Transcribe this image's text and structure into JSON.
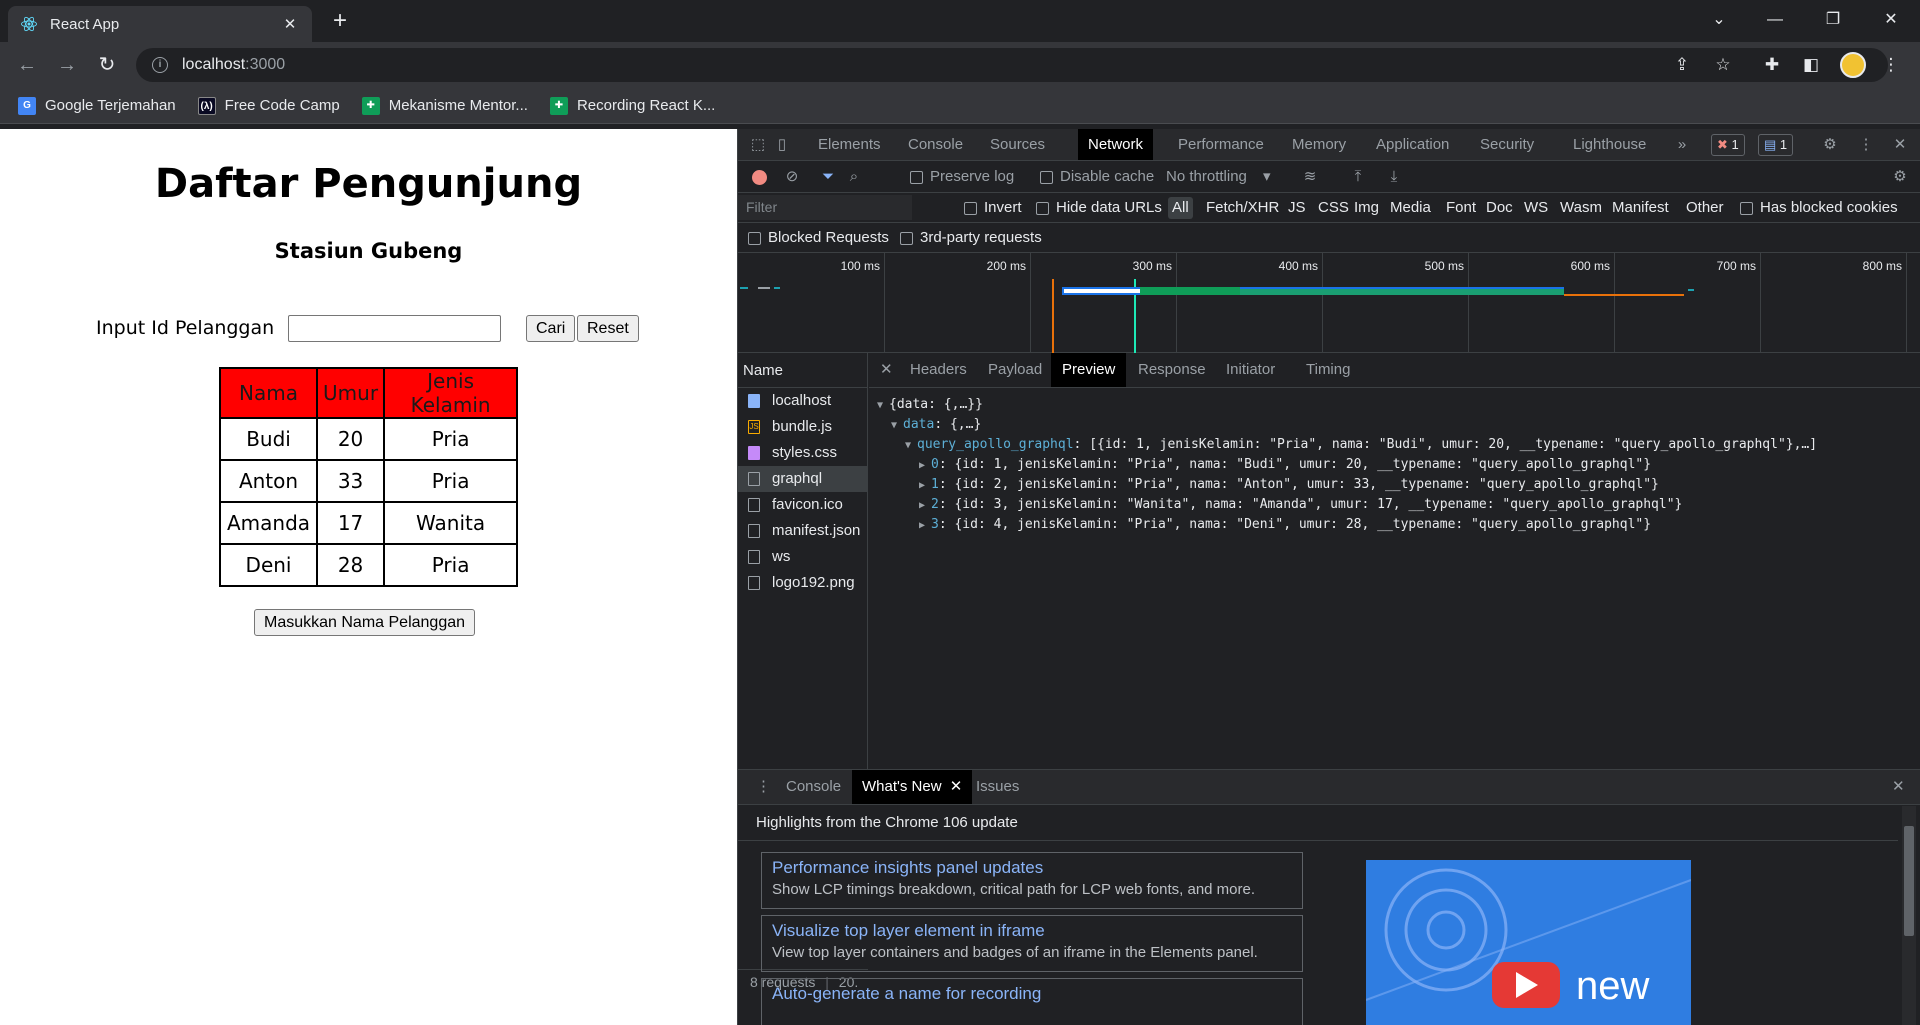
{
  "browser": {
    "tab_title": "React App",
    "url_host": "localhost",
    "url_port": ":3000",
    "bookmarks": [
      {
        "label": "Google Terjemahan",
        "icon": "google-translate-icon"
      },
      {
        "label": "Free Code Camp",
        "icon": "freecodecamp-icon"
      },
      {
        "label": "Mekanisme Mentor...",
        "icon": "sheets-icon"
      },
      {
        "label": "Recording React K...",
        "icon": "sheets-icon"
      }
    ]
  },
  "page": {
    "title": "Daftar Pengunjung",
    "subtitle": "Stasiun Gubeng",
    "input_label": "Input Id Pelanggan",
    "input_value": "",
    "search_button": "Cari",
    "reset_button": "Reset",
    "table_headers": [
      "Nama",
      "Umur",
      "Jenis Kelamin"
    ],
    "rows": [
      [
        "Budi",
        "20",
        "Pria"
      ],
      [
        "Anton",
        "33",
        "Pria"
      ],
      [
        "Amanda",
        "17",
        "Wanita"
      ],
      [
        "Deni",
        "28",
        "Pria"
      ]
    ],
    "add_button": "Masukkan Nama Pelanggan",
    "header_color": "#ff0000"
  },
  "devtools": {
    "tabs": [
      "Elements",
      "Console",
      "Sources",
      "Network",
      "Performance",
      "Memory",
      "Application",
      "Security",
      "Lighthouse"
    ],
    "active_tab": "Network",
    "error_count": "1",
    "message_count": "1",
    "toolbar": {
      "preserve_log": "Preserve log",
      "disable_cache": "Disable cache",
      "throttling": "No throttling"
    },
    "filter": {
      "placeholder": "Filter",
      "invert": "Invert",
      "hide_data_urls": "Hide data URLs",
      "types": [
        "All",
        "Fetch/XHR",
        "JS",
        "CSS",
        "Img",
        "Media",
        "Font",
        "Doc",
        "WS",
        "Wasm",
        "Manifest",
        "Other"
      ],
      "has_blocked_cookies": "Has blocked cookies",
      "blocked_requests": "Blocked Requests",
      "third_party": "3rd-party requests"
    },
    "timeline_labels": [
      "100 ms",
      "200 ms",
      "300 ms",
      "400 ms",
      "500 ms",
      "600 ms",
      "700 ms",
      "800 ms"
    ],
    "name_header": "Name",
    "requests": [
      {
        "name": "localhost",
        "icon": "document-icon"
      },
      {
        "name": "bundle.js",
        "icon": "script-icon"
      },
      {
        "name": "styles.css",
        "icon": "stylesheet-icon"
      },
      {
        "name": "graphql",
        "icon": "fetch-icon"
      },
      {
        "name": "favicon.ico",
        "icon": "file-icon"
      },
      {
        "name": "manifest.json",
        "icon": "file-icon"
      },
      {
        "name": "ws",
        "icon": "file-icon"
      },
      {
        "name": "logo192.png",
        "icon": "file-icon"
      }
    ],
    "selected_request": "graphql",
    "status": {
      "requests": "8 requests",
      "transferred": "20."
    },
    "detail_tabs": [
      "Headers",
      "Payload",
      "Preview",
      "Response",
      "Initiator",
      "Timing"
    ],
    "active_detail_tab": "Preview",
    "preview": {
      "root": "{data: {,…}}",
      "data_key": "data",
      "data_val": "{,…}",
      "query_key": "query_apollo_graphql",
      "query_val": "[{id: 1, jenisKelamin: \"Pria\", nama: \"Budi\", umur: 20, __typename: \"query_apollo_graphql\"},…]",
      "items": [
        {
          "idx": "0",
          "val": "{id: 1, jenisKelamin: \"Pria\", nama: \"Budi\", umur: 20, __typename: \"query_apollo_graphql\"}"
        },
        {
          "idx": "1",
          "val": "{id: 2, jenisKelamin: \"Pria\", nama: \"Anton\", umur: 33, __typename: \"query_apollo_graphql\"}"
        },
        {
          "idx": "2",
          "val": "{id: 3, jenisKelamin: \"Wanita\", nama: \"Amanda\", umur: 17, __typename: \"query_apollo_graphql\"}"
        },
        {
          "idx": "3",
          "val": "{id: 4, jenisKelamin: \"Pria\", nama: \"Deni\", umur: 28, __typename: \"query_apollo_graphql\"}"
        }
      ]
    },
    "drawer": {
      "tabs": [
        "Console",
        "What's New",
        "Issues"
      ],
      "active": "What's New",
      "highlights": "Highlights from the Chrome 106 update",
      "cards": [
        {
          "title": "Performance insights panel updates",
          "desc": "Show LCP timings breakdown, critical path for LCP web fonts, and more."
        },
        {
          "title": "Visualize top layer element in iframe",
          "desc": "View top layer containers and badges of an iframe in the Elements panel."
        },
        {
          "title": "Auto-generate a name for recording",
          "desc": ""
        }
      ],
      "video_caption": "new"
    }
  }
}
